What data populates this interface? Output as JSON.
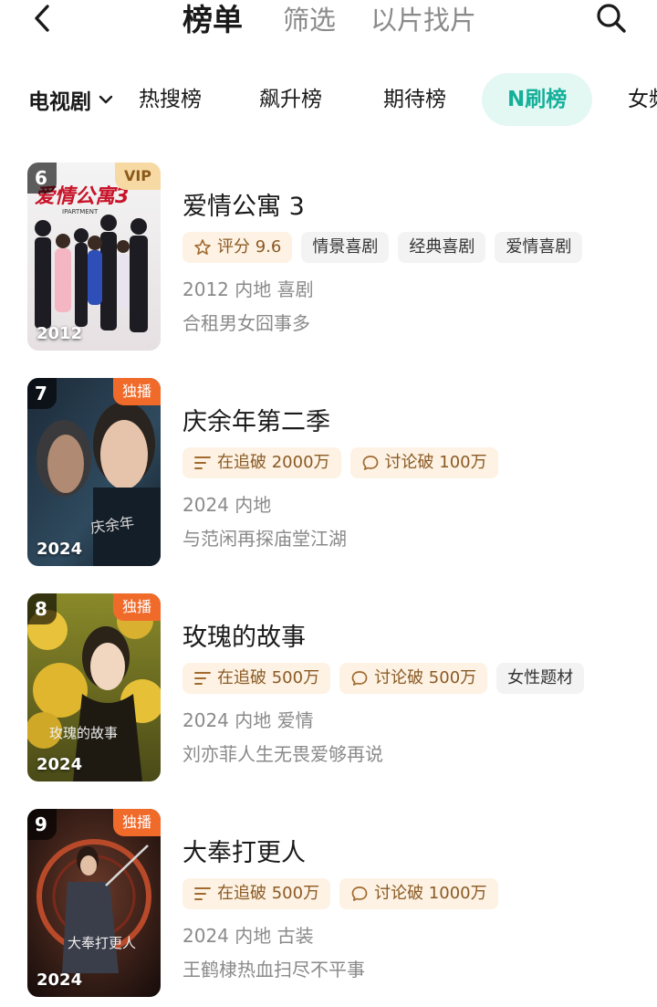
{
  "header": {
    "tabs": [
      {
        "label": "榜单",
        "active": true
      },
      {
        "label": "筛选",
        "active": false
      },
      {
        "label": "以片找片",
        "active": false
      }
    ],
    "icons": {
      "back": "chevron-left-icon",
      "search": "search-icon"
    }
  },
  "category": {
    "selected": "电视剧",
    "tabs": [
      "热搜榜",
      "飙升榜",
      "期待榜",
      "N刷榜",
      "女频"
    ],
    "active_tab": "N刷榜"
  },
  "colors": {
    "accent": "#15b09a",
    "exclusive_badge": "#f06a2a",
    "tag_bg": "#fdf2e3"
  },
  "items": [
    {
      "rank": "6",
      "badge": "VIP",
      "badge_type": "vip",
      "poster_year": "2012",
      "poster_text": "爱情公寓3",
      "poster_subtext": "IPARTMENT",
      "title": "爱情公寓 3",
      "tags": [
        {
          "icon": "star-icon",
          "label": "评分 9.6",
          "style": "orange"
        },
        {
          "label": "情景喜剧",
          "style": "gray"
        },
        {
          "label": "经典喜剧",
          "style": "gray"
        },
        {
          "label": "爱情喜剧",
          "style": "gray"
        }
      ],
      "meta": "2012 内地 喜剧",
      "desc": "合租男女囧事多"
    },
    {
      "rank": "7",
      "badge": "独播",
      "badge_type": "excl",
      "poster_year": "2024",
      "poster_text": "庆余年",
      "title": "庆余年第二季",
      "tags": [
        {
          "icon": "list-icon",
          "label": "在追破 2000万",
          "style": "orange"
        },
        {
          "icon": "comment-icon",
          "label": "讨论破 100万",
          "style": "orange"
        }
      ],
      "meta": "2024 内地",
      "desc": "与范闲再探庙堂江湖"
    },
    {
      "rank": "8",
      "badge": "独播",
      "badge_type": "excl",
      "poster_year": "2024",
      "poster_text": "玫瑰的故事",
      "title": "玫瑰的故事",
      "tags": [
        {
          "icon": "list-icon",
          "label": "在追破 500万",
          "style": "orange"
        },
        {
          "icon": "comment-icon",
          "label": "讨论破 500万",
          "style": "orange"
        },
        {
          "label": "女性题材",
          "style": "gray"
        }
      ],
      "meta": "2024 内地 爱情",
      "desc": "刘亦菲人生无畏爱够再说"
    },
    {
      "rank": "9",
      "badge": "独播",
      "badge_type": "excl",
      "poster_year": "2024",
      "poster_text": "大奉打更人",
      "title": "大奉打更人",
      "tags": [
        {
          "icon": "list-icon",
          "label": "在追破 500万",
          "style": "orange"
        },
        {
          "icon": "comment-icon",
          "label": "讨论破 1000万",
          "style": "orange"
        }
      ],
      "meta": "2024 内地 古装",
      "desc": "王鹤棣热血扫尽不平事"
    }
  ]
}
